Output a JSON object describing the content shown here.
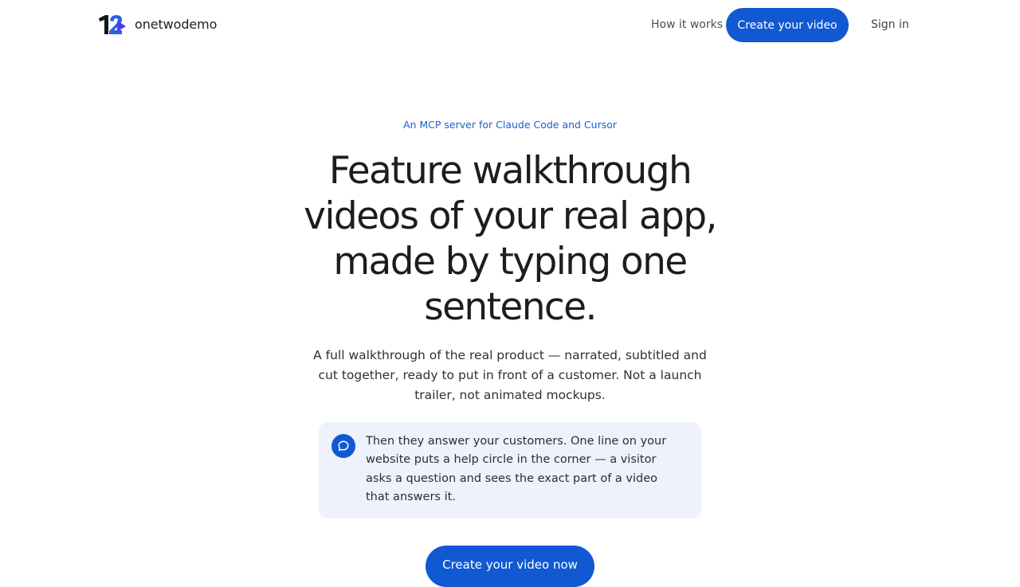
{
  "nav": {
    "brand_name": "onetwodemo",
    "how_it_works": "How it works",
    "cta": "Create your video",
    "sign_in": "Sign in"
  },
  "hero": {
    "eyebrow": "An MCP server for Claude Code and Cursor",
    "headline": "Feature walkthrough videos of your real app, made by typing one sentence.",
    "subhead": "A full walkthrough of the real product — narrated, subtitled and cut together, ready to put in front of a customer. Not a launch trailer, not animated mockups.",
    "callout": "Then they answer your customers. One line on your website puts a help circle in the corner — a visitor asks a question and sees the exact part of a video that answers it.",
    "cta": "Create your video now"
  },
  "icons": {
    "logo": "onetwodemo-logo-icon",
    "callout": "chat-bubble-icon"
  },
  "colors": {
    "accent": "#1158d3",
    "eyebrow": "#1a5fd1",
    "callout_bg": "#edf2fd",
    "text": "#1d1d1f"
  }
}
